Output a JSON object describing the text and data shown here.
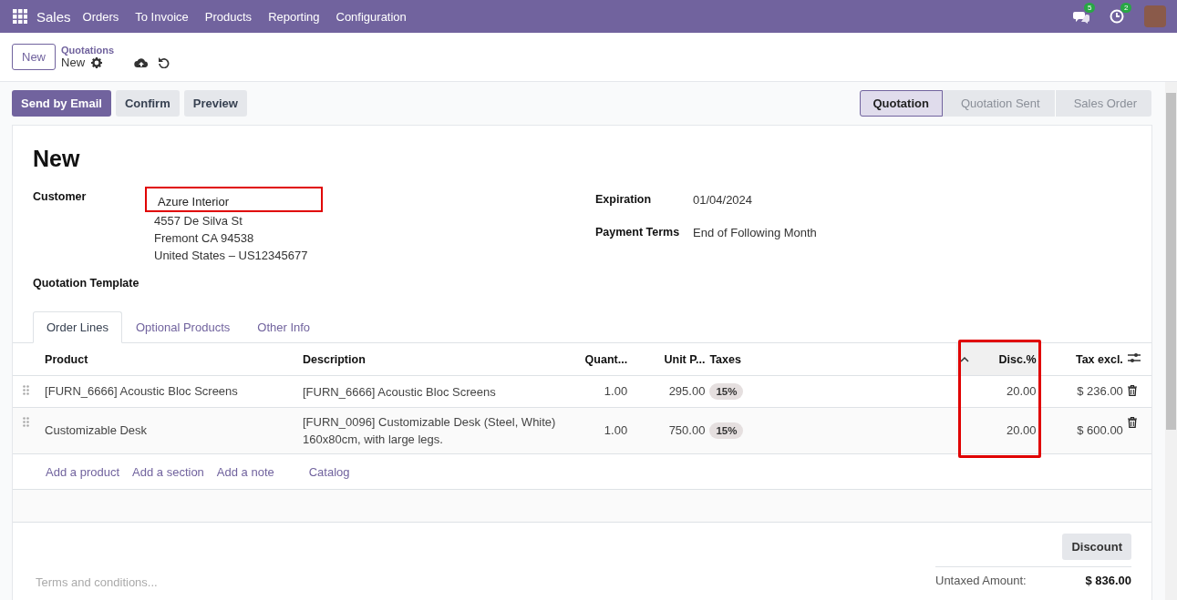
{
  "navbar": {
    "app": "Sales",
    "menu": [
      "Orders",
      "To Invoice",
      "Products",
      "Reporting",
      "Configuration"
    ],
    "systray": [
      {
        "kind": "chat",
        "badge": "5"
      },
      {
        "kind": "activity",
        "badge": "2"
      }
    ]
  },
  "control_panel": {
    "new_button": "New",
    "breadcrumb": "Quotations",
    "record": "New"
  },
  "actions": [
    {
      "label": "Send by Email",
      "primary": true
    },
    {
      "label": "Confirm",
      "primary": false
    },
    {
      "label": "Preview",
      "primary": false
    }
  ],
  "status_steps": [
    {
      "label": "Quotation",
      "selected": true
    },
    {
      "label": "Quotation Sent",
      "selected": false
    },
    {
      "label": "Sales Order",
      "selected": false
    }
  ],
  "form": {
    "title": "New",
    "customer": {
      "label": "Customer",
      "value": "Azure Interior",
      "address": [
        "4557 De Silva St",
        "Fremont CA 94538",
        "United States – US12345677"
      ]
    },
    "expiration": {
      "label": "Expiration",
      "value": "01/04/2024"
    },
    "payment_terms": {
      "label": "Payment Terms",
      "value": "End of Following Month"
    },
    "template": {
      "label": "Quotation Template"
    }
  },
  "tabs": [
    {
      "label": "Order Lines",
      "selected": true
    },
    {
      "label": "Optional Products",
      "selected": false
    },
    {
      "label": "Other Info",
      "selected": false
    }
  ],
  "table": {
    "columns": [
      {
        "label": "Product",
        "sorted": false
      },
      {
        "label": "Description",
        "sorted": false
      },
      {
        "label": "Quant...",
        "sorted": false
      },
      {
        "label": "Unit P...",
        "sorted": false
      },
      {
        "label": "Taxes",
        "sorted": false
      },
      {
        "label": "Disc.%",
        "sorted": true
      },
      {
        "label": "Tax excl.",
        "sorted": false
      }
    ],
    "rows": [
      {
        "product": "[FURN_6666] Acoustic Bloc Screens",
        "description": [
          "[FURN_6666] Acoustic Bloc Screens"
        ],
        "quantity": "1.00",
        "unit_price": "295.00",
        "taxes": "15%",
        "discount": "20.00",
        "subtotal": "$ 236.00"
      },
      {
        "product": "Customizable Desk",
        "description": [
          "[FURN_0096] Customizable Desk (Steel, White)",
          "160x80cm, with large legs."
        ],
        "quantity": "1.00",
        "unit_price": "750.00",
        "taxes": "15%",
        "discount": "20.00",
        "subtotal": "$ 600.00"
      }
    ],
    "add_links": [
      "Add a product",
      "Add a section",
      "Add a note",
      "Catalog"
    ]
  },
  "discount_button": "Discount",
  "terms": {
    "placeholder": "Terms and conditions..."
  },
  "totals": [
    {
      "label": "Untaxed Amount:",
      "value": "$ 836.00"
    }
  ]
}
